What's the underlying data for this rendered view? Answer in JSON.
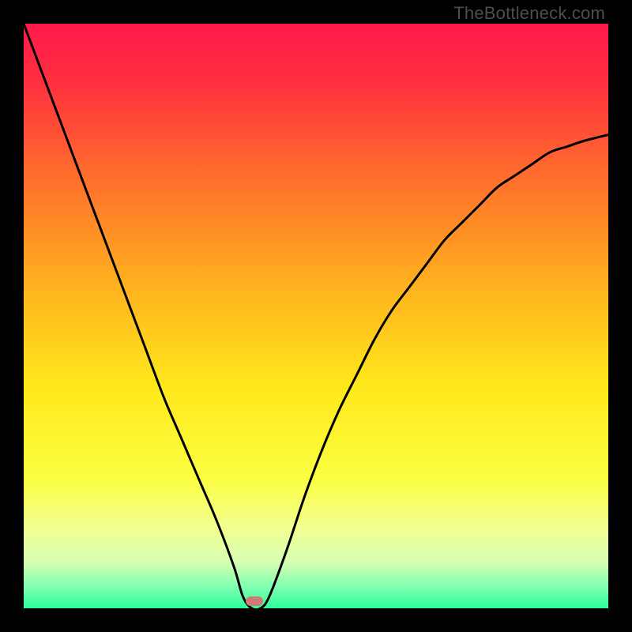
{
  "watermark": "TheBottleneck.com",
  "chart_data": {
    "type": "line",
    "title": "",
    "xlabel": "",
    "ylabel": "",
    "xlim": [
      0,
      100
    ],
    "ylim": [
      0,
      100
    ],
    "grid": false,
    "legend": false,
    "x": [
      0,
      3,
      6,
      9,
      12,
      15,
      18,
      21,
      24,
      27,
      30,
      33,
      36,
      37.5,
      39,
      40.5,
      42,
      45,
      48,
      51,
      54,
      57,
      60,
      63,
      66,
      69,
      72,
      75,
      78,
      81,
      84,
      87,
      90,
      93,
      96,
      100
    ],
    "values": [
      100,
      92,
      84,
      76,
      68,
      60,
      52,
      44,
      36,
      29,
      22,
      15,
      7,
      2,
      0,
      0,
      2,
      10,
      19,
      27,
      34,
      40,
      46,
      51,
      55,
      59,
      63,
      66,
      69,
      72,
      74,
      76,
      78,
      79,
      80,
      81
    ],
    "annotations": []
  },
  "colors": {
    "gradient_stops": [
      {
        "offset": 0.0,
        "color": "#ff1a4b"
      },
      {
        "offset": 0.1,
        "color": "#ff2f3f"
      },
      {
        "offset": 0.25,
        "color": "#ff6a2d"
      },
      {
        "offset": 0.45,
        "color": "#ffb21f"
      },
      {
        "offset": 0.62,
        "color": "#ffe81a"
      },
      {
        "offset": 0.78,
        "color": "#fbff42"
      },
      {
        "offset": 0.86,
        "color": "#f3ff8f"
      },
      {
        "offset": 0.92,
        "color": "#d7ffb3"
      },
      {
        "offset": 0.965,
        "color": "#7cffb0"
      },
      {
        "offset": 1.0,
        "color": "#2dff98"
      }
    ],
    "curve_stroke": "#000000",
    "curve_width": 3,
    "marker_fill": "#cf7a78",
    "marker_x_frac": 0.395,
    "marker_y_frac": 0.988
  }
}
